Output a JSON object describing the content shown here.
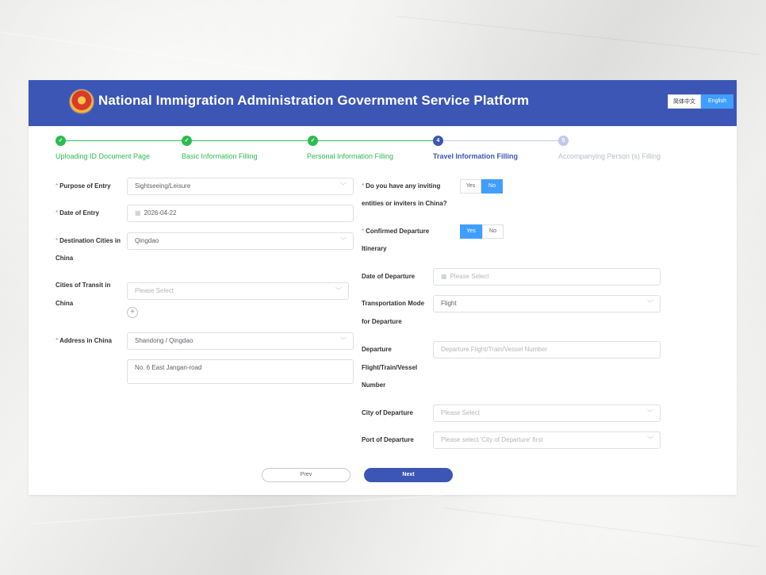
{
  "header": {
    "title": "National Immigration Administration Government Service Platform",
    "lang_zh": "简体中文",
    "lang_en": "English",
    "colors": {
      "header_bg": "#3c56b5",
      "active_lang": "#409eff"
    }
  },
  "steps": [
    {
      "label": "Uploading ID Document Page",
      "state": "done",
      "mark": "✓"
    },
    {
      "label": "Basic Information Filling",
      "state": "done",
      "mark": "✓"
    },
    {
      "label": "Personal Information Filling",
      "state": "done",
      "mark": "✓"
    },
    {
      "label": "Travel Information Filling",
      "state": "active",
      "mark": "4"
    },
    {
      "label": "Accompanying Person (s) Filling",
      "state": "pending",
      "mark": "5"
    }
  ],
  "step_colors": {
    "done": "#2dbb4f",
    "active": "#3c56b5",
    "pending": "#c3c8ea"
  },
  "left": {
    "purpose_label": "Purpose of Entry",
    "purpose_value": "Sightseeing/Leisure",
    "date_label": "Date of Entry",
    "date_value": "2026-04-22",
    "dest_label_1": "Destination Cities in",
    "dest_label_2": "China",
    "dest_value": "Qingdao",
    "transit_label_1": "Cities of Transit in",
    "transit_label_2": "China",
    "transit_placeholder": "Please Select",
    "address_label": "Address in China",
    "address_region": "Shandong / Qingdao",
    "address_detail": "No. 6 East Jangan-road"
  },
  "right": {
    "inviting_label_1": "Do you have any inviting",
    "inviting_label_2": "entities or inviters in China?",
    "inviting_yes": "Yes",
    "inviting_no": "No",
    "itinerary_label_1": "Confirmed Departure",
    "itinerary_label_2": "Itinerary",
    "itinerary_yes": "Yes",
    "itinerary_no": "No",
    "dep_date_label": "Date of Departure",
    "dep_date_placeholder": "Please Select",
    "transport_label_1": "Transportation Mode",
    "transport_label_2": "for Departure",
    "transport_value": "Flight",
    "flight_label_1": "Departure",
    "flight_label_2": "Flight/Train/Vessel",
    "flight_label_3": "Number",
    "flight_placeholder": "Departure Flight/Train/Vessel Number",
    "city_dep_label": "City of Departure",
    "city_dep_placeholder": "Please Select",
    "port_dep_label": "Port of Departure",
    "port_dep_placeholder": "Please select 'City of Departure' first"
  },
  "nav": {
    "prev": "Prev",
    "next": "Next"
  },
  "required_mark": "*",
  "icons": {
    "chevron": "chevron-down-icon",
    "calendar": "calendar-icon",
    "plus": "plus-circle-icon"
  }
}
